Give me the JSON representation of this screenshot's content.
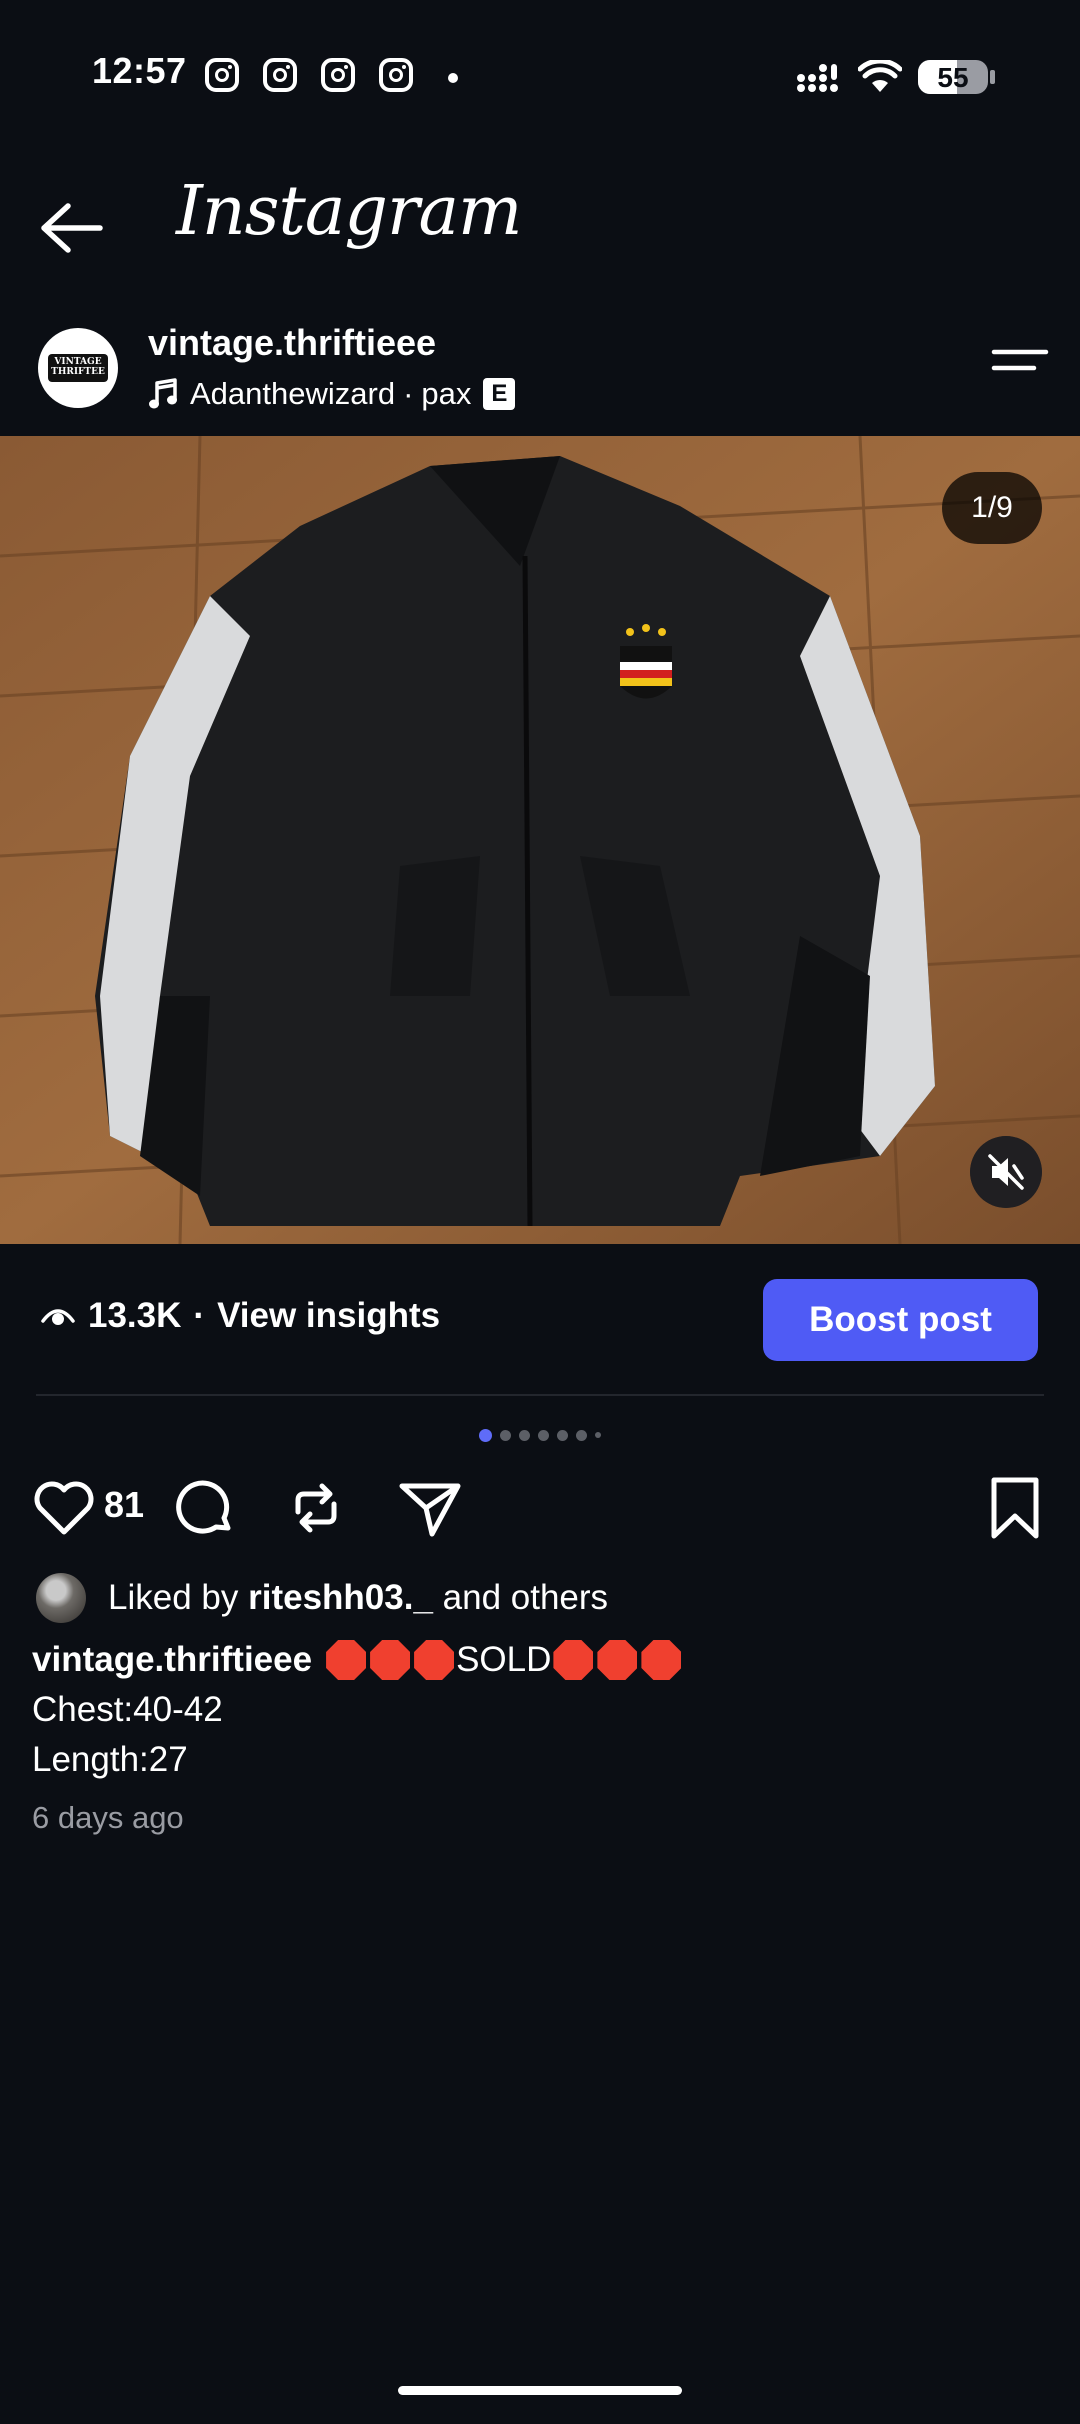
{
  "status_bar": {
    "time": "12:57",
    "battery_percent": "55",
    "battery_level": 0.55,
    "notification_icons": [
      "instagram-icon",
      "instagram-icon",
      "instagram-icon",
      "instagram-icon"
    ]
  },
  "header": {
    "title": "Instagram",
    "back_icon": "arrow-left-icon"
  },
  "post": {
    "username": "vintage.thriftieee",
    "avatar_text": "VINTAGE THRIFTEE",
    "audio_artist": "Adanthewizard",
    "audio_separator": "·",
    "audio_track": "pax",
    "explicit_badge": "E",
    "page_counter": "1/9",
    "image_description_icon": "black-track-jacket-photo"
  },
  "insights": {
    "views": "13.3K",
    "separator": "·",
    "link_label": "View insights",
    "boost_label": "Boost post"
  },
  "carousel": {
    "total_dots": 7,
    "active_index": 0,
    "active_color": "#5f6cf8"
  },
  "actions": {
    "like_count": "81"
  },
  "likes": {
    "prefix": "Liked by",
    "user": "riteshh03._",
    "suffix": "and others"
  },
  "caption": {
    "username": "vintage.thriftieee",
    "sold_text": "SOLD",
    "line2": "Chest:40-42",
    "line3": "Length:27",
    "time_ago": "6 days ago"
  },
  "colors": {
    "background": "#0b0e14",
    "boost": "#4f5bf5",
    "stop_sign": "#f0402f"
  }
}
